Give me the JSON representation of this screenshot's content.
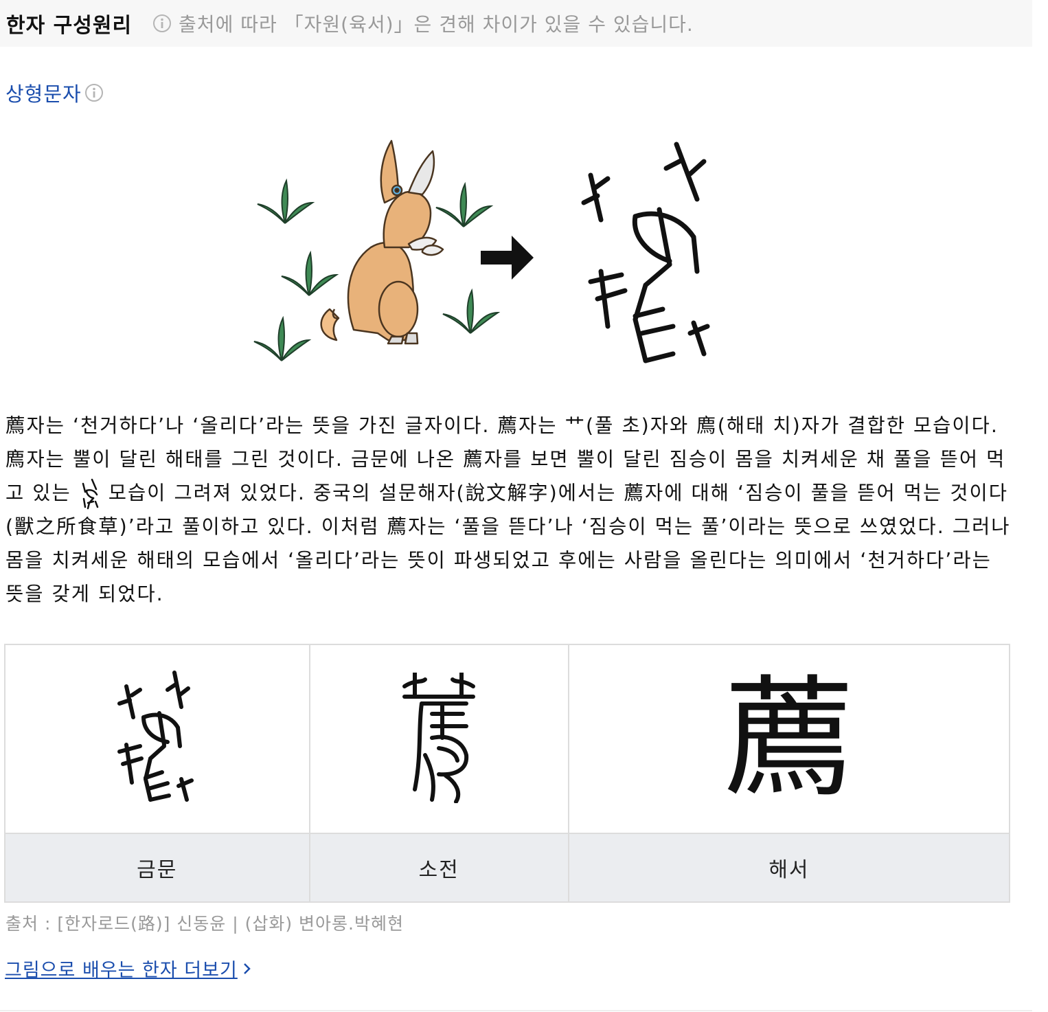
{
  "header": {
    "title": "한자 구성원리",
    "note": "출처에 따라 「자원(육서)」은 견해 차이가 있을 수 있습니다."
  },
  "type_label": "상형문자",
  "description": {
    "part1": "薦자는 ‘천거하다’나 ‘올리다’라는 뜻을 가진 글자이다. 薦자는 艹(풀 초)자와 廌(해태 치)자가 결합한 모습이다. 廌자는 뿔이 달린 해태를 그린 것이다. 금문에 나온 薦자를 보면 뿔이 달린 짐승이 몸을 치켜세운 채 풀을 뜯어 먹고 있는",
    "part2": "모습이 그려져 있었다. 중국의 설문해자(說文解字)에서는 薦자에 대해 ‘짐승이 풀을 뜯어 먹는 것이다(獸之所食草)’라고 풀이하고 있다. 이처럼 薦자는 ‘풀을 뜯다’나 ‘짐승이 먹는 풀’이라는 뜻으로 쓰였었다. 그러나 몸을 치켜세운 해태의 모습에서 ‘올리다’라는 뜻이 파생되었고 후에는 사람을 올린다는 의미에서 ‘천거하다’라는 뜻을 갖게 되었다."
  },
  "evolution": {
    "kaishu_char": "薦",
    "labels": [
      "금문",
      "소전",
      "해서"
    ]
  },
  "source": "출처 : [한자로드(路)] 신동윤 | (삽화) 변아롱.박혜현",
  "more_link": "그림으로 배우는 한자 더보기",
  "icons": {
    "info": "info-icon",
    "arrow": "arrow-right-icon",
    "chevron": "chevron-right-icon"
  },
  "colors": {
    "accent": "#1a4dad",
    "header_bg": "#f7f7f7",
    "label_bg": "#ebedf0",
    "muted": "#999999"
  }
}
